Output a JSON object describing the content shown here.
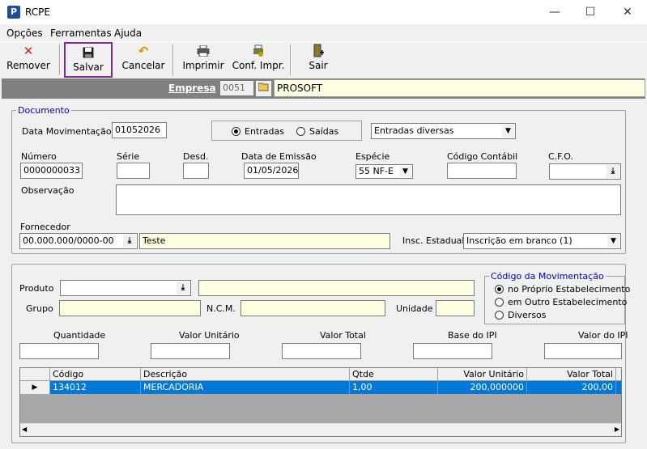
{
  "window": {
    "title": "RCPE",
    "app_icon": "P",
    "minimize": "—",
    "maximize": "☐",
    "close": "✕"
  },
  "menu": [
    "Opções",
    "Ferramentas",
    "Ajuda"
  ],
  "toolbar": {
    "remover": "Remover",
    "salvar": "Salvar",
    "cancelar": "Cancelar",
    "imprimir": "Imprimir",
    "conf_impr": "Conf. Impr.",
    "sair": "Sair"
  },
  "empresa": {
    "label": "Empresa",
    "code": "0051",
    "name": "PROSOFT"
  },
  "documento": {
    "legend": "Documento",
    "data_mov_label": "Data Movimentação",
    "data_mov": "01052026",
    "entradas": "Entradas",
    "saidas": "Saídas",
    "tipo_selected": "Entradas",
    "tipo_mov": "Entradas diversas",
    "numero_label": "Número",
    "numero": "0000000033",
    "serie_label": "Série",
    "serie": "",
    "desd_label": "Desd.",
    "desd": "",
    "data_emissao_label": "Data de Emissão",
    "data_emissao": "01/05/2026",
    "especie_label": "Espécie",
    "especie": "55 NF-E",
    "cod_contabil_label": "Código Contábil",
    "cod_contabil": "",
    "cfo_label": "C.F.O.",
    "cfo": "",
    "observacao_label": "Observação",
    "observacao": "",
    "fornecedor_label": "Fornecedor",
    "fornecedor_cnpj": "00.000.000/0000-00",
    "fornecedor_nome": "Teste",
    "insc_label": "Insc. Estadual",
    "insc": "Inscrição em branco (1)"
  },
  "item": {
    "produto_label": "Produto",
    "produto": "",
    "produto_desc": "",
    "grupo_label": "Grupo",
    "grupo": "",
    "ncm_label": "N.C.M.",
    "ncm": "",
    "unidade_label": "Unidade",
    "unidade": "",
    "cod_mov_legend": "Código da Movimentação",
    "cod_mov_opts": [
      "no Próprio Estabelecimento",
      "em Outro Estabelecimento",
      "Diversos"
    ],
    "cod_mov_selected": "no Próprio Estabelecimento",
    "quantidade_label": "Quantidade",
    "valor_unit_label": "Valor Unitário",
    "valor_total_label": "Valor Total",
    "base_ipi_label": "Base do IPI",
    "valor_ipi_label": "Valor do IPI"
  },
  "grid": {
    "columns": [
      "Código",
      "Descrição",
      "Qtde",
      "Valor Unitário",
      "Valor Total"
    ],
    "rows": [
      {
        "codigo": "134012",
        "descricao": "MERCADORIA",
        "qtde": "1,00",
        "valor_unitario": "200,000000",
        "valor_total": "200,00"
      }
    ]
  },
  "colors": {
    "accent": "#0078d7",
    "highlight_border": "#7b2d8e",
    "yellow_field": "#ffffe1",
    "legend_blue": "#0000c0"
  }
}
